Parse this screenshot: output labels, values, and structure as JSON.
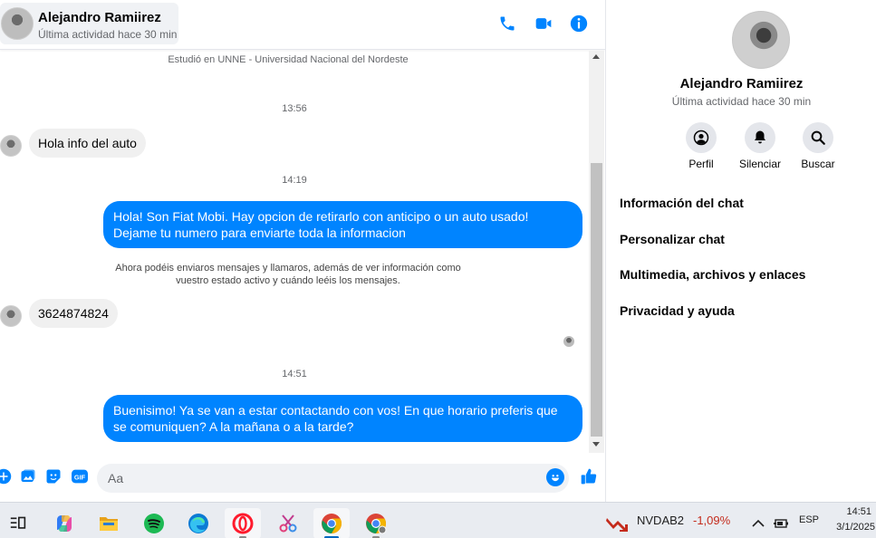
{
  "contact": {
    "name": "Alejandro Ramiirez",
    "status": "Última actividad hace 30 min"
  },
  "conversation": {
    "top_note": "Estudió en UNNE - Universidad Nacional del Nordeste",
    "time_1": "13:56",
    "msg_in_1": "Hola info del auto",
    "time_2": "14:19",
    "msg_out_1": "Hola! Son Fiat Mobi. Hay opcion de retirarlo con anticipo o un auto usado! Dejame tu numero para enviarte toda la informacion",
    "system_notice_line1": "Ahora podéis enviaros mensajes y llamaros, además de ver información como",
    "system_notice_line2": "vuestro estado activo y cuándo leéis los mensajes.",
    "msg_in_2": "3624874824",
    "time_3": "14:51",
    "msg_out_2": "Buenisimo! Ya se van a estar contactando con vos! En que horario preferis que se comuniquen? A la mañana o a la tarde?"
  },
  "composer": {
    "placeholder": "Aa",
    "gif_label": "GIF"
  },
  "info_panel": {
    "name": "Alejandro Ramiirez",
    "status": "Última actividad hace 30 min",
    "actions": {
      "profile": "Perfil",
      "mute": "Silenciar",
      "search": "Buscar"
    },
    "menu": {
      "chat_info": "Información del chat",
      "customize": "Personalizar chat",
      "media": "Multimedia, archivos y enlaces",
      "privacy": "Privacidad y ayuda"
    }
  },
  "taskbar": {
    "stock_symbol": "NVDAB2",
    "stock_change": "-1,09%",
    "language": "ESP",
    "time": "14:51",
    "date": "3/1/2025"
  },
  "colors": {
    "messenger_blue": "#0084ff",
    "stock_down": "#c42b1c"
  }
}
